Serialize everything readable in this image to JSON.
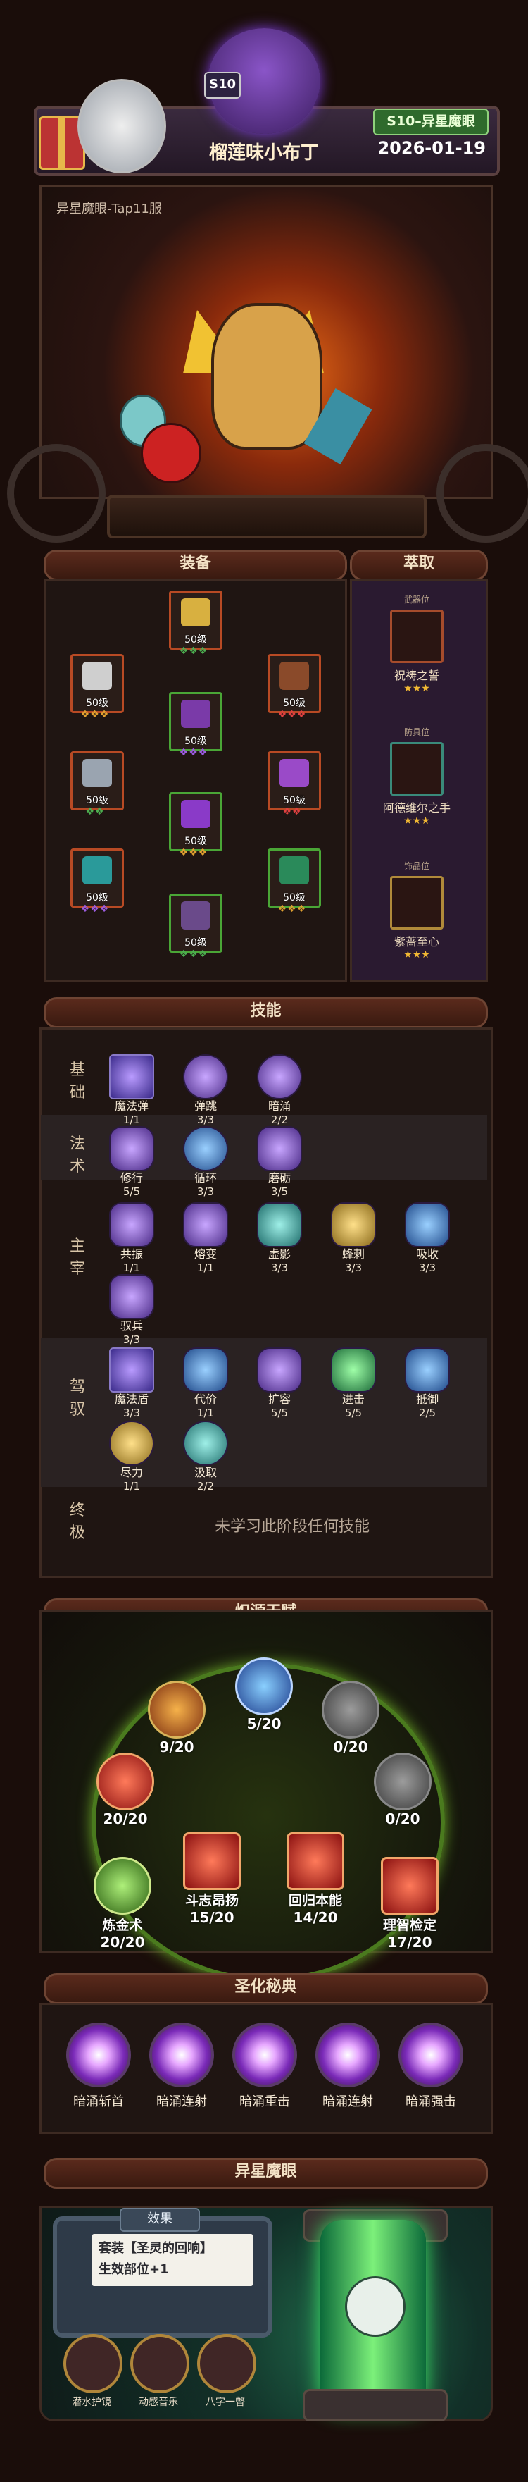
{
  "header": {
    "season_badge": "S10",
    "season_tag": "S10–异星魔眼",
    "nickname": "榴莲味小布丁",
    "date": "2026-01-19"
  },
  "hero": {
    "server": "异星魔眼-Tap11服"
  },
  "sections": {
    "equipment": "装备",
    "extraction": "萃取",
    "skills": "技能",
    "talents": "炽源天赋",
    "codex": "圣化秘典",
    "alien_eye": "异星魔眼"
  },
  "equipment": [
    {
      "level": "50级",
      "gems": "❖❖❖",
      "gem_color": "#4caf50"
    },
    {
      "level": "50级",
      "gems": "❖❖❖",
      "gem_color": "#e0a030"
    },
    {
      "level": "50级",
      "gems": "❖❖❖",
      "gem_color": "#e04040"
    },
    {
      "level": "50级",
      "gems": "❖❖❖",
      "gem_color": "#9c5ce0"
    },
    {
      "level": "50级",
      "gems": "❖❖",
      "gem_color": "#4caf50"
    },
    {
      "level": "50级",
      "gems": "❖❖",
      "gem_color": "#e04040"
    },
    {
      "level": "50级",
      "gems": "❖❖❖",
      "gem_color": "#e0a030"
    },
    {
      "level": "50级",
      "gems": "❖❖❖",
      "gem_color": "#9c5ce0"
    },
    {
      "level": "50级",
      "gems": "❖❖❖",
      "gem_color": "#e0a030"
    },
    {
      "level": "50级",
      "gems": "❖❖❖",
      "gem_color": "#4caf50"
    },
    {
      "level": "50级",
      "gems": "❖❖",
      "gem_color": "#e0a030"
    }
  ],
  "extraction": [
    {
      "slot": "武器位",
      "name": "祝祷之誓",
      "stars": "★★★"
    },
    {
      "slot": "防具位",
      "name": "阿德维尔之手",
      "stars": "★★★"
    },
    {
      "slot": "饰品位",
      "name": "紫蔷至心",
      "stars": "★★★"
    }
  ],
  "skills": {
    "labels": {
      "basic": "基础",
      "spell": "法术",
      "dominate": "主宰",
      "drive": "驾驭",
      "ultimate": "终极"
    },
    "basic": [
      {
        "name": "魔法弹",
        "level": "1/1"
      },
      {
        "name": "弹跳",
        "level": "3/3"
      },
      {
        "name": "暗涌",
        "level": "2/2"
      }
    ],
    "spell": [
      {
        "name": "修行",
        "level": "5/5"
      },
      {
        "name": "循环",
        "level": "3/3"
      },
      {
        "name": "磨砺",
        "level": "3/5"
      }
    ],
    "dominate": [
      {
        "name": "共振",
        "level": "1/1"
      },
      {
        "name": "熔变",
        "level": "1/1"
      },
      {
        "name": "虚影",
        "level": "3/3"
      },
      {
        "name": "蜂刺",
        "level": "3/3"
      },
      {
        "name": "吸收",
        "level": "3/3"
      },
      {
        "name": "驭兵",
        "level": "3/3"
      }
    ],
    "drive": [
      {
        "name": "魔法盾",
        "level": "3/3"
      },
      {
        "name": "代价",
        "level": "1/1"
      },
      {
        "name": "扩容",
        "level": "5/5"
      },
      {
        "name": "进击",
        "level": "5/5"
      },
      {
        "name": "抵御",
        "level": "2/5"
      },
      {
        "name": "尽力",
        "level": "1/1"
      },
      {
        "name": "汲取",
        "level": "2/2"
      }
    ],
    "ultimate_text": "未学习此阶段任何技能"
  },
  "talents": [
    {
      "value": "9/20",
      "name": ""
    },
    {
      "value": "5/20",
      "name": ""
    },
    {
      "value": "0/20",
      "name": ""
    },
    {
      "value": "20/20",
      "name": ""
    },
    {
      "value": "0/20",
      "name": ""
    },
    {
      "value": "20/20",
      "name": "炼金术"
    },
    {
      "value": "15/20",
      "name": "斗志昂扬"
    },
    {
      "value": "14/20",
      "name": "回归本能"
    },
    {
      "value": "17/20",
      "name": "理智检定"
    }
  ],
  "codex": [
    {
      "name": "暗涌斩首"
    },
    {
      "name": "暗涌连射"
    },
    {
      "name": "暗涌重击"
    },
    {
      "name": "暗涌连射"
    },
    {
      "name": "暗涌强击"
    }
  ],
  "alien_eye": {
    "effect_title": "效果",
    "effect_line1": "套装【圣灵的回响】",
    "effect_line2": "生效部位+1",
    "slots": [
      {
        "name": "潜水护镜"
      },
      {
        "name": "动感音乐"
      },
      {
        "name": "八字一瞥"
      }
    ]
  }
}
